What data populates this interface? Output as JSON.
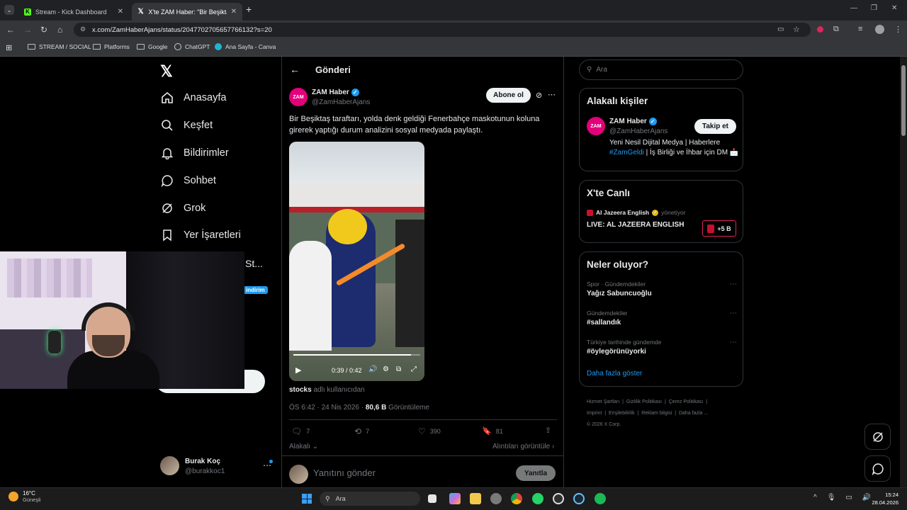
{
  "browser": {
    "tabs": [
      {
        "title": "Stream - Kick Dashboard",
        "active": false
      },
      {
        "title": "X'te ZAM Haber: \"Bir Beşiktaş ta",
        "active": true
      }
    ],
    "url": "x.com/ZamHaberAjans/status/2047702705657766132?s=20",
    "bookmarks": [
      "STREAM / SOCIAL",
      "Platforms",
      "Google",
      "ChatGPT",
      "Ana Sayfa - Canva"
    ]
  },
  "sidebar": {
    "items": [
      {
        "label": "Anasayfa",
        "icon": "home-icon"
      },
      {
        "label": "Keşfet",
        "icon": "search-icon"
      },
      {
        "label": "Bildirimler",
        "icon": "bell-icon"
      },
      {
        "label": "Sohbet",
        "icon": "chat-icon"
      },
      {
        "label": "Grok",
        "icon": "grok-icon"
      },
      {
        "label": "Yer İşaretleri",
        "icon": "bookmark-icon"
      }
    ],
    "partial_label": "St...",
    "partial_badge": "indirim",
    "account": {
      "name": "Burak Koç",
      "handle": "@burakkoc1"
    }
  },
  "post": {
    "header_title": "Gönderi",
    "author_name": "ZAM Haber",
    "author_handle": "@ZamHaberAjans",
    "subscribe_label": "Abone ol",
    "text": "Bir Beşiktaş taraftarı, yolda denk geldiği Fenerbahçe maskotunun koluna girerek yaptığı durum analizini sosyal medyada paylaştı.",
    "video": {
      "time": "0:39 / 0:42",
      "progress": 0.93
    },
    "source_user": "stocks",
    "source_suffix": "adlı kullanıcıdan",
    "timestamp": "ÖS 6:42 · 24 Nis 2026 · ",
    "views": "80,6 B",
    "views_label": "Görüntüleme",
    "stats": {
      "replies": "7",
      "reposts": "7",
      "likes": "390",
      "bookmarks": "81"
    },
    "related_label": "Alakalı",
    "quotes_label": "Alıntıları görüntüle",
    "reply_placeholder": "Yanıtını gönder",
    "reply_button": "Yanıtla"
  },
  "right": {
    "search_placeholder": "Ara",
    "relevant": {
      "title": "Alakalı kişiler",
      "name": "ZAM Haber",
      "handle": "@ZamHaberAjans",
      "follow_label": "Takip et",
      "bio_1": "Yeni Nesil Dijital Medya | Haberlere",
      "bio_tag": "#ZamGeldi",
      "bio_2": " | İş Birliği ve İhbar için DM",
      "bio_emoji": "📩"
    },
    "live": {
      "title": "X'te Canlı",
      "host": "Al Jazeera English",
      "host_suffix": "yönetiyor",
      "stream_title": "LIVE: AL JAZEERA ENGLISH",
      "count": "+5 B"
    },
    "trends": {
      "title": "Neler oluyor?",
      "items": [
        {
          "context": "Spor · Gündemdekiler",
          "name": "Yağız Sabuncuoğlu"
        },
        {
          "context": "Gündemdekiler",
          "name": "#sallandık"
        },
        {
          "context": "Türkiye tarihinde gündemde",
          "name": "#öylegörünüyorki"
        }
      ],
      "more": "Daha fazla göster"
    },
    "footer": [
      "Hizmet Şartları",
      "Gizlilik Politikası",
      "Çerez Politikası",
      "Imprint",
      "Erişilebilirlik",
      "Reklam bilgisi",
      "Daha fazla ...",
      "© 2026 X Corp."
    ]
  },
  "taskbar": {
    "weather_temp": "16°C",
    "weather_text": "Güneşli",
    "search_placeholder": "Ara",
    "time": "15:24",
    "date": "28.04.2026"
  }
}
